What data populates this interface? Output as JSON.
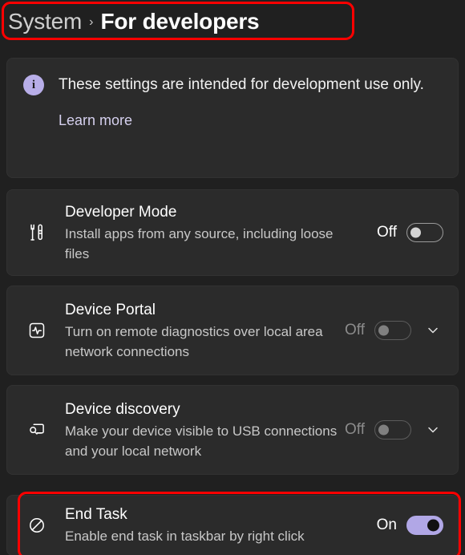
{
  "header": {
    "parent_crumb": "System",
    "separator": "›",
    "current_crumb": "For developers"
  },
  "info_banner": {
    "icon": "info-circle-icon",
    "message": "These settings are intended for development use only.",
    "link_label": "Learn more"
  },
  "settings": [
    {
      "key": "developer_mode",
      "icon": "tools-icon",
      "title": "Developer Mode",
      "description": "Install apps from any source, including loose files",
      "state_label": "Off",
      "state": "off",
      "disabled": false,
      "has_expander": false
    },
    {
      "key": "device_portal",
      "icon": "pulse-monitor-icon",
      "title": "Device Portal",
      "description": "Turn on remote diagnostics over local area network connections",
      "state_label": "Off",
      "state": "off",
      "disabled": true,
      "has_expander": true,
      "expander_icon": "chevron-down-icon"
    },
    {
      "key": "device_discovery",
      "icon": "device-search-icon",
      "title": "Device discovery",
      "description": "Make your device visible to USB connections and your local network",
      "state_label": "Off",
      "state": "off",
      "disabled": true,
      "has_expander": true,
      "expander_icon": "chevron-down-icon"
    },
    {
      "key": "end_task",
      "icon": "prohibition-icon",
      "title": "End Task",
      "description": "Enable end task in taskbar by right click",
      "state_label": "On",
      "state": "on",
      "disabled": false,
      "has_expander": false
    }
  ],
  "annotations": {
    "highlight_color": "#ff0000",
    "boxes": [
      "breadcrumb-header",
      "end-task-row"
    ]
  },
  "colors": {
    "page_background": "#202020",
    "card_background": "#2b2b2b",
    "accent_purple": "#b1a7e6",
    "info_icon_purple": "#b8aee8",
    "text_primary": "#ffffff",
    "text_secondary": "#c8c8c8",
    "text_disabled": "#8b8b8b"
  }
}
